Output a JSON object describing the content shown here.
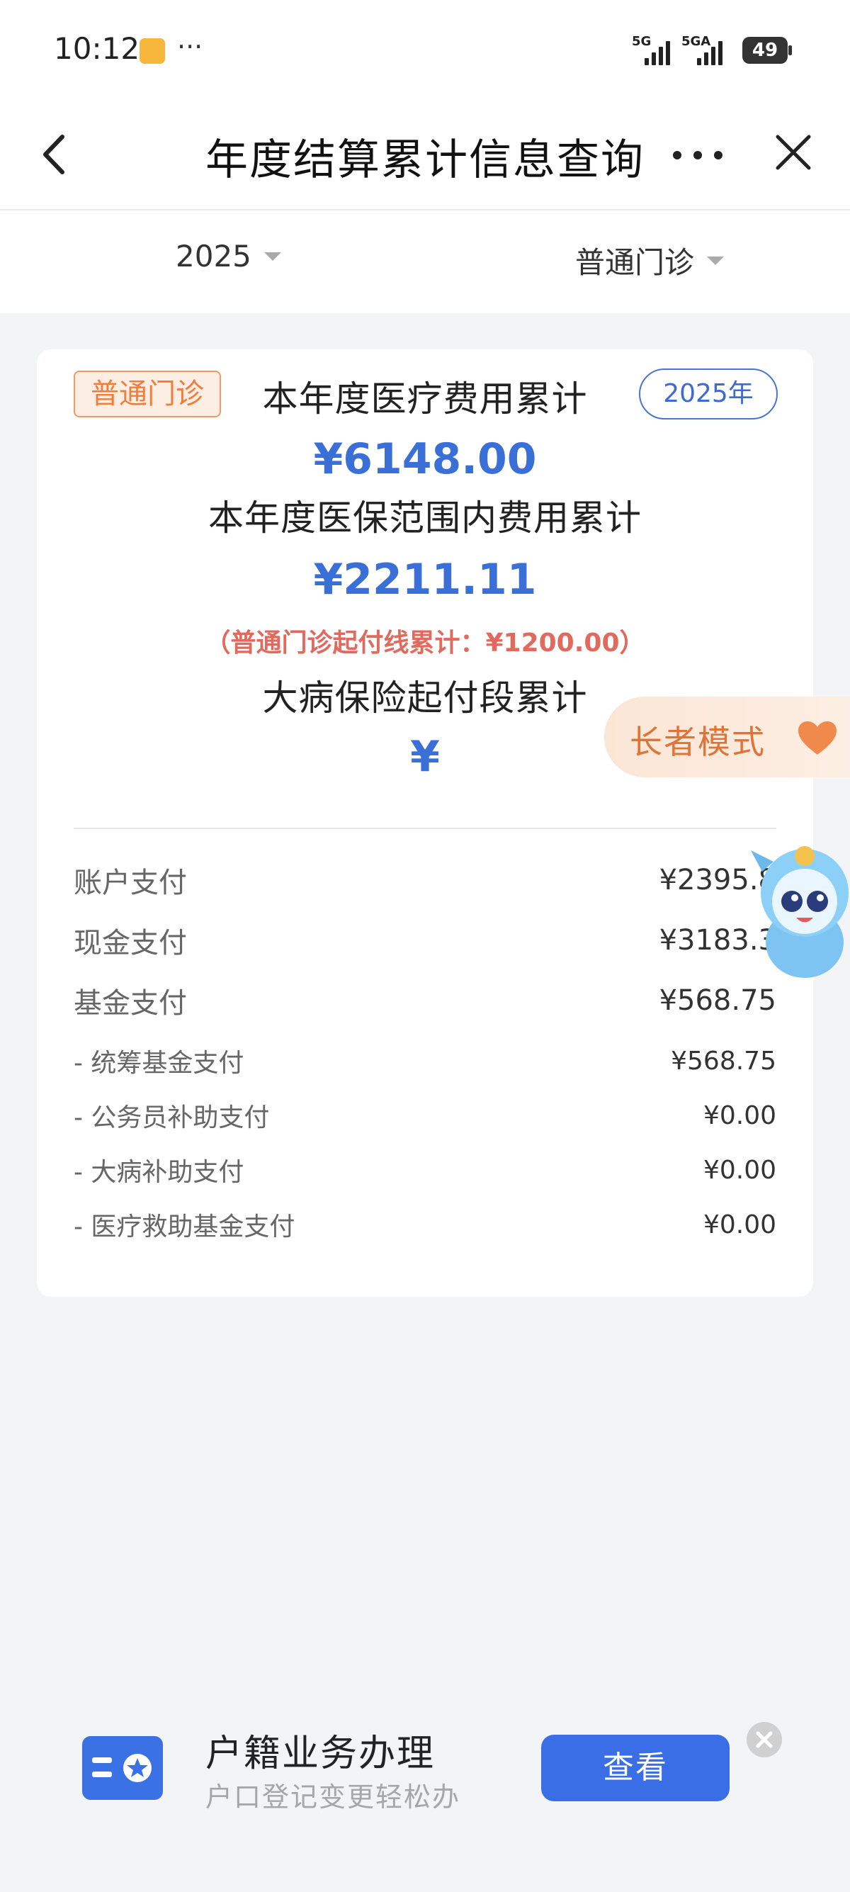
{
  "status_bar": {
    "time": "10:12",
    "dots": "···",
    "signal1_label": "5G",
    "signal2_label": "5GA",
    "battery": "49",
    "icons": [
      "note-icon",
      "signal-5g-icon",
      "signal-5ga-icon",
      "battery-icon"
    ]
  },
  "nav": {
    "title": "年度结算累计信息查询",
    "icons": [
      "back-arrow-icon",
      "more-icon",
      "close-icon"
    ]
  },
  "filters": {
    "year": "2025",
    "category": "普通门诊"
  },
  "card": {
    "tag": "普通门诊",
    "year_badge": "2025年",
    "total_label": "本年度医疗费用累计",
    "total_value": "¥6148.00",
    "insured_label": "本年度医保范围内费用累计",
    "insured_value": "¥2211.11",
    "threshold_note": "（普通门诊起付线累计：¥1200.00）",
    "critical_label": "大病保险起付段累计",
    "critical_value": "¥",
    "rows": [
      {
        "label": "账户支付",
        "value": "¥2395.8"
      },
      {
        "label": "现金支付",
        "value": "¥3183.3"
      },
      {
        "label": "基金支付",
        "value": "¥568.75"
      }
    ],
    "sub_rows": [
      {
        "label": "- 统筹基金支付",
        "value": "¥568.75"
      },
      {
        "label": "- 公务员补助支付",
        "value": "¥0.00"
      },
      {
        "label": "- 大病补助支付",
        "value": "¥0.00"
      },
      {
        "label": "- 医疗救助基金支付",
        "value": "¥0.00"
      }
    ]
  },
  "senior_mode": {
    "label": "长者模式",
    "icon": "heart-icon"
  },
  "banner": {
    "title": "户籍业务办理",
    "subtitle": "户口登记变更轻松办",
    "button": "查看",
    "icons": [
      "id-card-icon",
      "close-circle-icon"
    ]
  },
  "colors": {
    "accent_blue": "#3b6fd8",
    "orange": "#ef7d3b",
    "red_note": "#e06a5e"
  }
}
